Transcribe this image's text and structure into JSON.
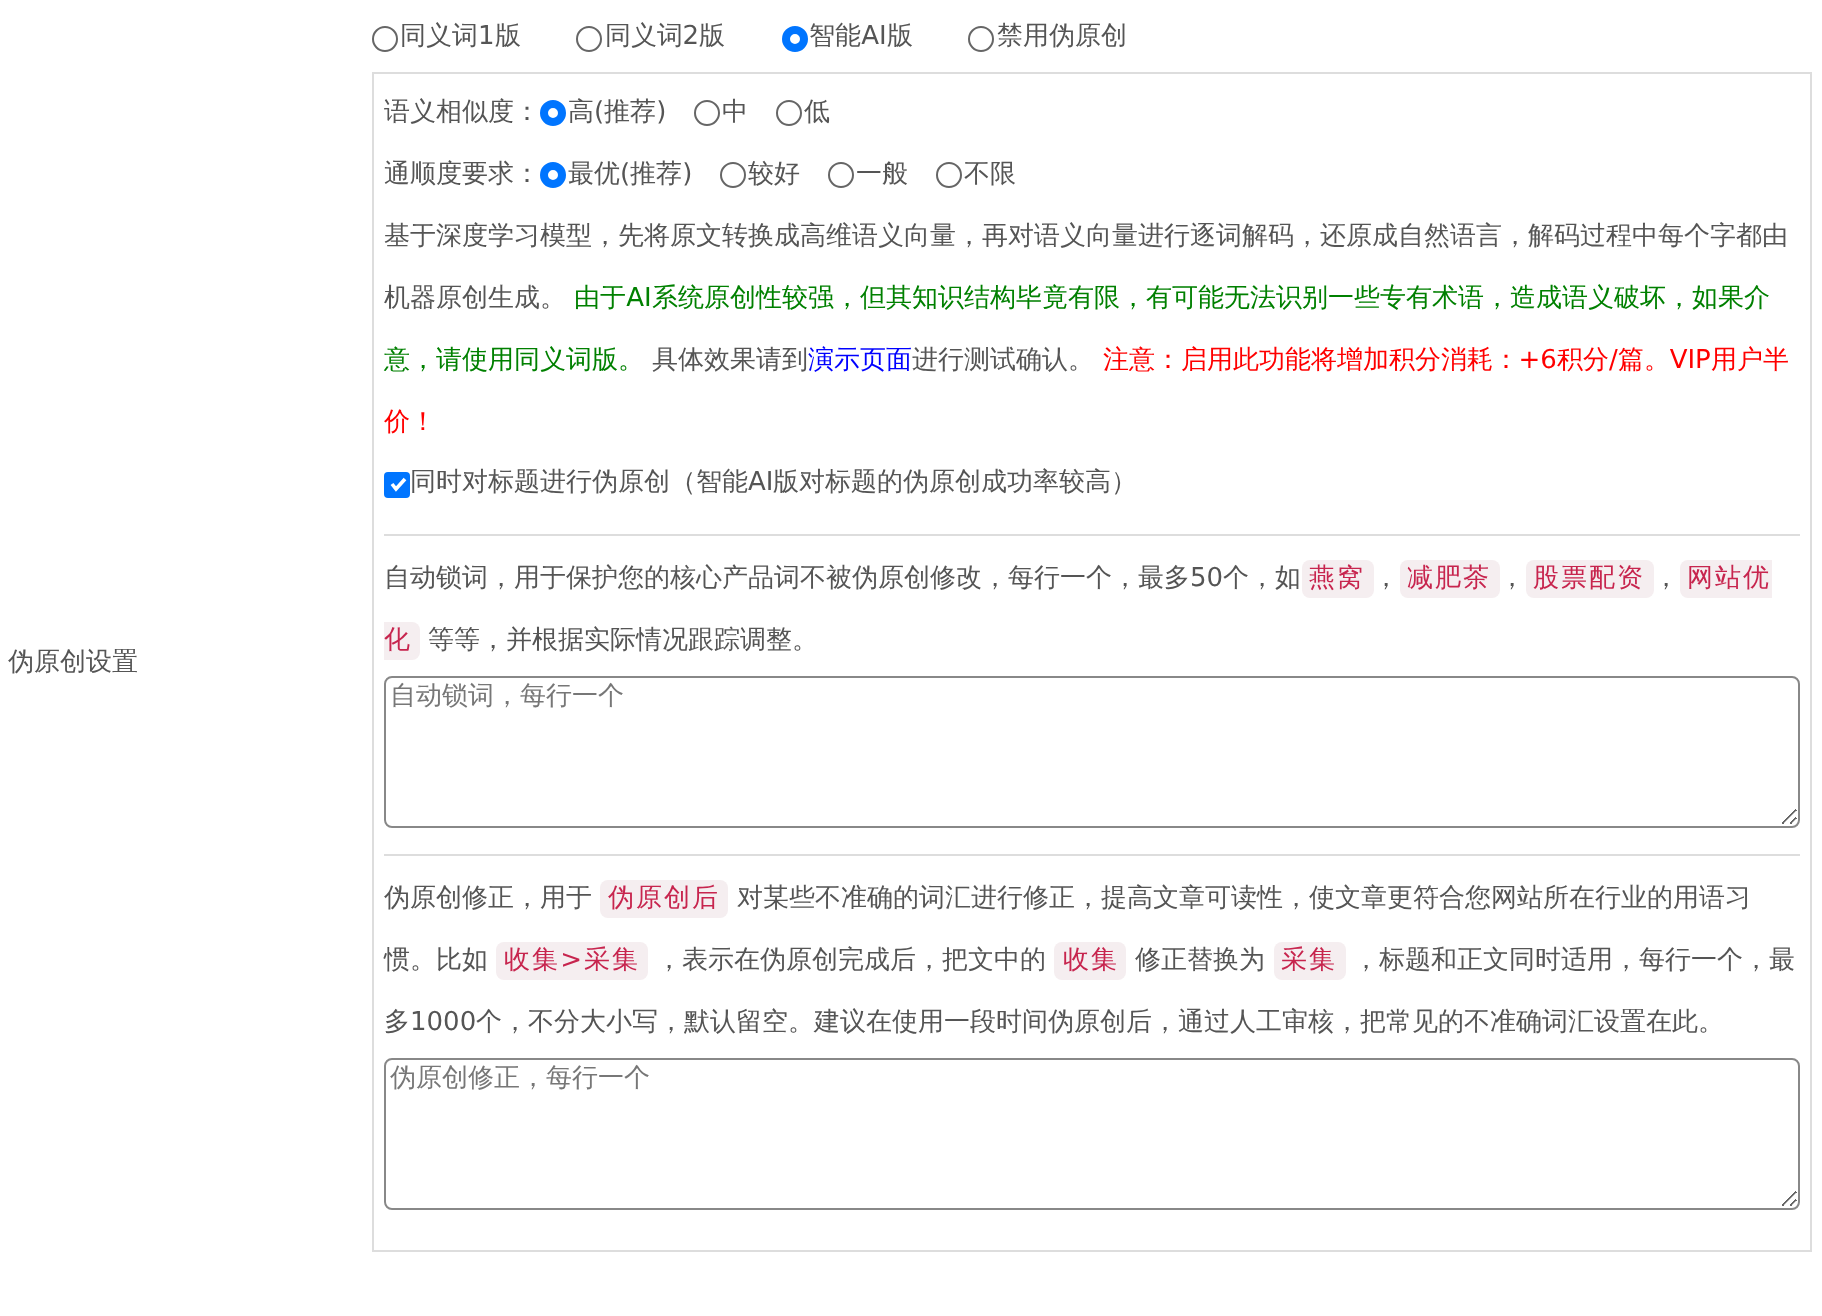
{
  "section_label": "伪原创设置",
  "modes": [
    {
      "label": "同义词1版",
      "selected": false
    },
    {
      "label": "同义词2版",
      "selected": false
    },
    {
      "label": "智能AI版",
      "selected": true
    },
    {
      "label": "禁用伪原创",
      "selected": false
    }
  ],
  "ai_panel": {
    "similarity": {
      "label": "语义相似度：",
      "options": [
        {
          "label": "高(推荐)",
          "selected": true
        },
        {
          "label": "中",
          "selected": false
        },
        {
          "label": "低",
          "selected": false
        }
      ]
    },
    "fluency": {
      "label": "通顺度要求：",
      "options": [
        {
          "label": "最优(推荐)",
          "selected": true
        },
        {
          "label": "较好",
          "selected": false
        },
        {
          "label": "一般",
          "selected": false
        },
        {
          "label": "不限",
          "selected": false
        }
      ]
    },
    "description": [
      {
        "kind": "text",
        "text": "基于深度学习模型，先将原文转换成高维语义向量，再对语义向量进行逐词解码，还原成自然语言，解码过程中每个字都由机器原创生成。 "
      },
      {
        "kind": "note",
        "text": "由于AI系统原创性较强，但其知识结构毕竟有限，有可能无法识别一些专有术语，造成语义破坏，如果介意，请使用同义词版。"
      },
      {
        "kind": "text",
        "text": " 具体效果请到"
      },
      {
        "kind": "link",
        "text": "演示页面"
      },
      {
        "kind": "text",
        "text": "进行测试确认。 "
      },
      {
        "kind": "warning",
        "text": "注意：启用此功能将增加积分消耗：+6积分/篇。VIP用户半价！"
      }
    ],
    "title_option": {
      "label": "同时对标题进行伪原创（智能AI版对标题的伪原创成功率较高）",
      "checked": true
    }
  },
  "lock_words": {
    "description": [
      {
        "kind": "text",
        "text": "自动锁词，用于保护您的核心产品词不被伪原创修改，每行一个，最多50个，如"
      },
      {
        "kind": "code",
        "text": "燕窝"
      },
      {
        "kind": "text",
        "text": "，"
      },
      {
        "kind": "code",
        "text": "减肥茶"
      },
      {
        "kind": "text",
        "text": "，"
      },
      {
        "kind": "code",
        "text": "股票配资"
      },
      {
        "kind": "text",
        "text": "，"
      },
      {
        "kind": "code",
        "text": "网站优化"
      },
      {
        "kind": "text",
        "text": " 等等，并根据实际情况跟踪调整。"
      }
    ],
    "placeholder": "自动锁词，每行一个"
  },
  "corrections": {
    "description": [
      {
        "kind": "text",
        "text": "伪原创修正，用于 "
      },
      {
        "kind": "code",
        "text": "伪原创后"
      },
      {
        "kind": "text",
        "text": " 对某些不准确的词汇进行修正，提高文章可读性，使文章更符合您网站所在行业的用语习惯。比如 "
      },
      {
        "kind": "code",
        "text": "收集>采集"
      },
      {
        "kind": "text",
        "text": " ，表示在伪原创完成后，把文中的 "
      },
      {
        "kind": "code",
        "text": "收集"
      },
      {
        "kind": "text",
        "text": " 修正替换为 "
      },
      {
        "kind": "code",
        "text": "采集"
      },
      {
        "kind": "text",
        "text": " ，标题和正文同时适用，每行一个，最多1000个，不分大小写，默认留空。建议在使用一段时间伪原创后，通过人工审核，把常见的不准确词汇设置在此。"
      }
    ],
    "placeholder": "伪原创修正，每行一个"
  }
}
